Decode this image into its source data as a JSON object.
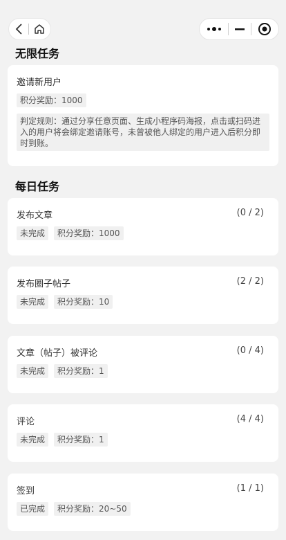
{
  "nav": {
    "back_icon": "chevron-left-icon",
    "home_icon": "home-icon",
    "more_icon": "more-dots-icon",
    "minimize_icon": "minimize-icon",
    "close_icon": "target-close-icon"
  },
  "unlimited": {
    "section_title": "无限任务",
    "card": {
      "title": "邀请新用户",
      "reward": "积分奖励：1000",
      "rule": "判定规则：通过分享任意页面、生成小程序码海报，点击或扫码进入的用户将会绑定邀请账号，未曾被他人绑定的用户进入后积分即时到账。"
    }
  },
  "daily": {
    "section_title": "每日任务",
    "tasks": [
      {
        "title": "发布文章",
        "progress": "(0 / 2)",
        "status": "未完成",
        "reward": "积分奖励：1000"
      },
      {
        "title": "发布圈子帖子",
        "progress": "(2 / 2)",
        "status": "未完成",
        "reward": "积分奖励：10"
      },
      {
        "title": "文章（帖子）被评论",
        "progress": "(0 / 4)",
        "status": "未完成",
        "reward": "积分奖励：1"
      },
      {
        "title": "评论",
        "progress": "(4 / 4)",
        "status": "未完成",
        "reward": "积分奖励：1"
      },
      {
        "title": "签到",
        "progress": "(1 / 1)",
        "status": "已完成",
        "reward": "积分奖励：20~50"
      }
    ]
  }
}
